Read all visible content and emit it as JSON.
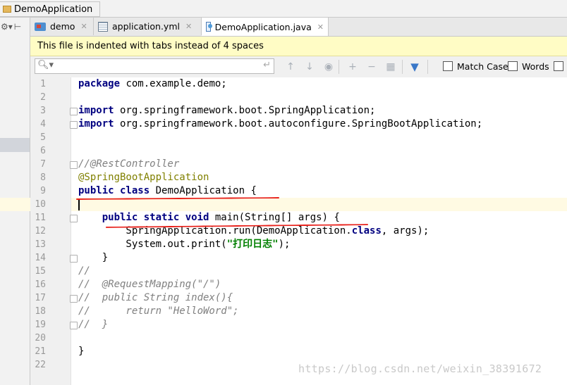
{
  "breadcrumb": {
    "label": "DemoApplication"
  },
  "tabs": [
    {
      "label": "demo",
      "icon": "module-icon",
      "active": false
    },
    {
      "label": "application.yml",
      "icon": "yml-file-icon",
      "active": false
    },
    {
      "label": "DemoApplication.java",
      "icon": "java-class-icon",
      "active": true
    }
  ],
  "notice": {
    "text": "This file is indented with tabs instead of 4 spaces"
  },
  "findbar": {
    "search_value": "",
    "match_case_label": "Match Case",
    "words_label": "Words",
    "match_case_checked": false,
    "words_checked": false
  },
  "editor": {
    "line_numbers": [
      "1",
      "2",
      "3",
      "4",
      "5",
      "6",
      "7",
      "8",
      "9",
      "10",
      "11",
      "12",
      "13",
      "14",
      "15",
      "16",
      "17",
      "18",
      "19",
      "20",
      "21",
      "22"
    ],
    "caret_line": 10,
    "lines": {
      "l1_kw": "package",
      "l1_rest": " com.example.demo;",
      "l3_kw": "import",
      "l3_rest": " org.springframework.boot.SpringApplication;",
      "l4_kw": "import",
      "l4_rest": " org.springframework.boot.autoconfigure.SpringBootApplication;",
      "l7": "//@RestController",
      "l8": "@SpringBootApplication",
      "l9_kw": "public class",
      "l9_rest": " DemoApplication {",
      "l11_indent": "    ",
      "l11_kw": "public static void",
      "l11_rest": " main(String[] args) {",
      "l12_a": "        SpringApplication.run(DemoApplication.",
      "l12_kw": "class",
      "l12_b": ", args);",
      "l13_a": "        System.out.print(",
      "l13_str": "\"打印日志\"",
      "l13_b": ");",
      "l14": "    }",
      "l15": "//",
      "l16": "//  @RequestMapping(\"/\")",
      "l17": "//  public String index(){",
      "l18": "//      return \"HelloWord\";",
      "l19": "//  }",
      "l21": "}"
    }
  },
  "watermark": "https://blog.csdn.net/weixin_38391672",
  "colors": {
    "keyword": "#000080",
    "annotation": "#808000",
    "comment": "#808080",
    "string": "#008000",
    "red_mark": "#e8201a",
    "notice_bg": "#fffcc5"
  }
}
